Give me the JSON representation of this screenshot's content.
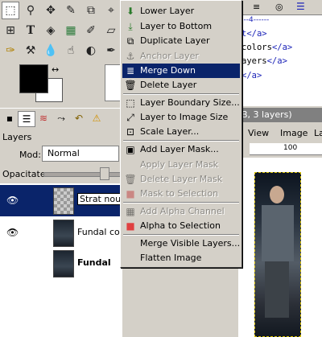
{
  "right_panel": {
    "code_lines": [
      {
        "prefix": "",
        "tag": "t</a>"
      },
      {
        "prefix": " colors",
        "tag": "</a>"
      },
      {
        "prefix": "ayers",
        "tag": "</a>"
      },
      {
        "prefix": "",
        "tag": "</a>"
      }
    ]
  },
  "layers_dock": {
    "title": "Layers",
    "mode_label": "Mod:",
    "mode_value": "Normal",
    "opacity_label": "Opacitate:",
    "opacity_level": 0.8,
    "layers": [
      {
        "name": "Strat nou",
        "selected": true,
        "visible": true
      },
      {
        "name": "Fundal cop",
        "selected": false,
        "visible": true
      },
      {
        "name": "Fundal",
        "selected": false,
        "visible": false
      }
    ]
  },
  "image_window": {
    "title_fragment": "B, 3 layers)",
    "menu": [
      "View",
      "Image",
      "La"
    ],
    "ruler_mark": "100"
  },
  "context_menu": {
    "items": [
      {
        "label": "Lower Layer",
        "icon": "arrow-down-icon",
        "disabled": false
      },
      {
        "label": "Layer to Bottom",
        "icon": "arrow-bottom-icon",
        "disabled": false
      },
      {
        "label": "Duplicate Layer",
        "icon": "duplicate-icon",
        "disabled": false
      },
      {
        "label": "Anchor Layer",
        "icon": "anchor-icon",
        "disabled": true
      },
      {
        "label": "Merge Down",
        "icon": "merge-icon",
        "disabled": false,
        "highlighted": true
      },
      {
        "label": "Delete Layer",
        "icon": "trash-icon",
        "disabled": false
      },
      {
        "label": "Layer Boundary Size...",
        "icon": "boundary-icon",
        "disabled": false
      },
      {
        "label": "Layer to Image Size",
        "icon": "resize-icon",
        "disabled": false
      },
      {
        "label": "Scale Layer...",
        "icon": "scale-icon",
        "disabled": false
      },
      {
        "label": "Add Layer Mask...",
        "icon": "mask-add-icon",
        "disabled": false
      },
      {
        "label": "Apply Layer Mask",
        "icon": "mask-apply-icon",
        "disabled": true
      },
      {
        "label": "Delete Layer Mask",
        "icon": "mask-delete-icon",
        "disabled": true
      },
      {
        "label": "Mask to Selection",
        "icon": "mask-selection-icon",
        "disabled": true
      },
      {
        "label": "Add Alpha Channel",
        "icon": "alpha-add-icon",
        "disabled": true
      },
      {
        "label": "Alpha to Selection",
        "icon": "alpha-selection-icon",
        "disabled": false
      },
      {
        "label": "Merge Visible Layers...",
        "icon": "",
        "disabled": false
      },
      {
        "label": "Flatten Image",
        "icon": "",
        "disabled": false
      }
    ]
  }
}
